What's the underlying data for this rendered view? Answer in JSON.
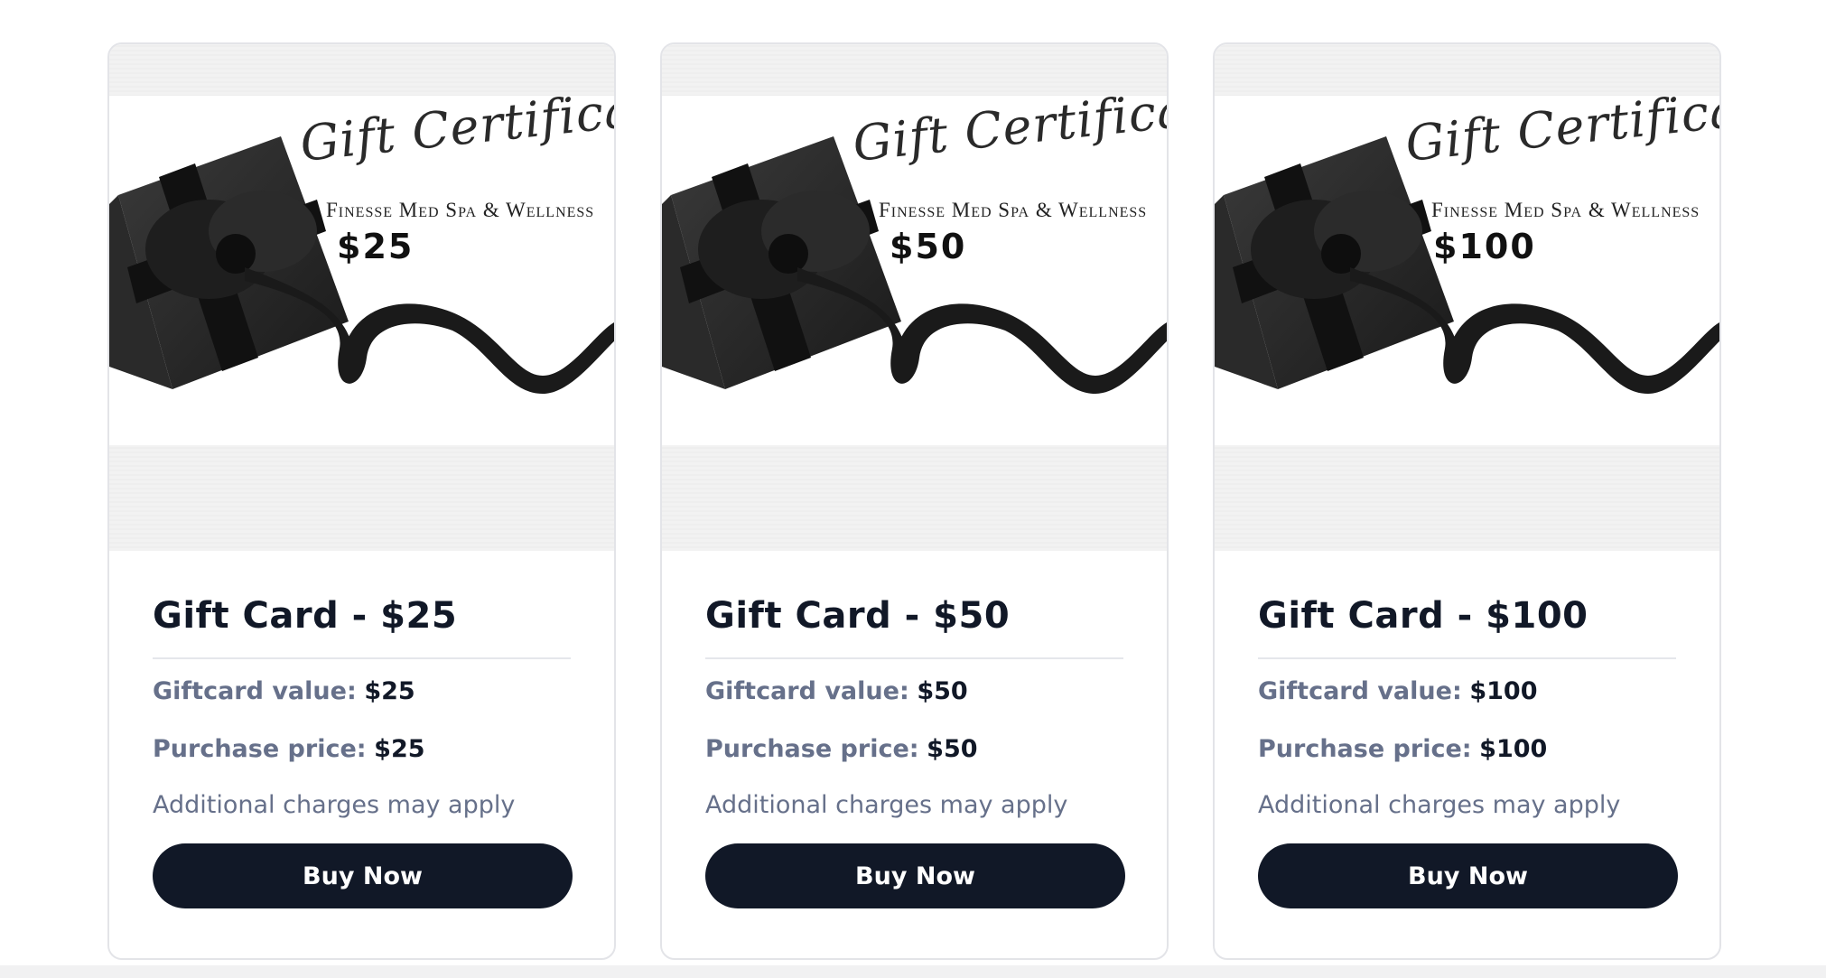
{
  "cards": [
    {
      "image": {
        "script_title": "Gift Certificate",
        "spa_name": "Finesse Med Spa & Wellness",
        "amount": "$25"
      },
      "title": "Gift Card - $25",
      "value_label": "Giftcard value:",
      "value": "$25",
      "price_label": "Purchase price:",
      "price": "$25",
      "note": "Additional charges may apply",
      "button_label": "Buy Now"
    },
    {
      "image": {
        "script_title": "Gift Certificate",
        "spa_name": "Finesse Med Spa & Wellness",
        "amount": "$50"
      },
      "title": "Gift Card - $50",
      "value_label": "Giftcard value:",
      "value": "$50",
      "price_label": "Purchase price:",
      "price": "$50",
      "note": "Additional charges may apply",
      "button_label": "Buy Now"
    },
    {
      "image": {
        "script_title": "Gift Certificate",
        "spa_name": "Finesse Med Spa & Wellness",
        "amount": "$100"
      },
      "title": "Gift Card - $100",
      "value_label": "Giftcard value:",
      "value": "$100",
      "price_label": "Purchase price:",
      "price": "$100",
      "note": "Additional charges may apply",
      "button_label": "Buy Now"
    }
  ],
  "colors": {
    "button_bg": "#111827",
    "label": "#66708a",
    "title": "#111827"
  }
}
